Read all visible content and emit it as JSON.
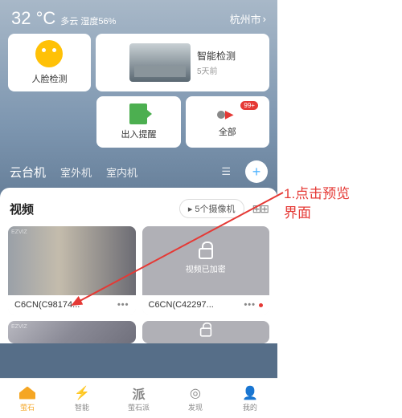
{
  "header": {
    "temp": "32 °C",
    "condition": "多云 湿度56%",
    "city": "杭州市"
  },
  "features": {
    "face": "人脸检测",
    "smart_title": "智能检测",
    "smart_sub": "5天前",
    "entry": "出入提醒",
    "all": "全部",
    "badge": "99+"
  },
  "tabs": {
    "t1": "云台机",
    "t2": "室外机",
    "t3": "室内机"
  },
  "video": {
    "title": "视频",
    "count": "5个摄像机",
    "locked_text": "视频已加密",
    "cam1": "C6CN(C98174...",
    "cam2": "C6CN(C42297...",
    "more": "•••"
  },
  "nav": {
    "n1": "萤石",
    "n2": "智能",
    "n3": "萤石派",
    "n4": "发现",
    "n5": "我的"
  },
  "annotation": {
    "line1": "1.点击预览",
    "line2": "界面"
  }
}
